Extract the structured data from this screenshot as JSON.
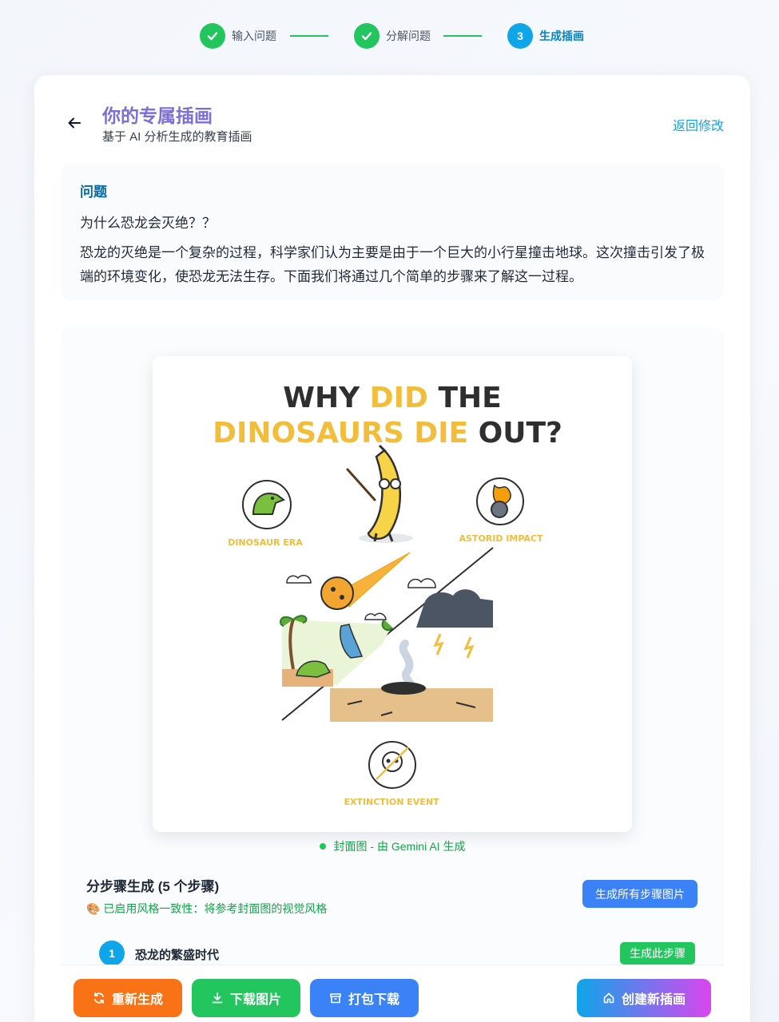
{
  "stepper": {
    "steps": [
      {
        "label": "输入问题",
        "number": "",
        "state": "done"
      },
      {
        "label": "分解问题",
        "number": "",
        "state": "done"
      },
      {
        "label": "生成插画",
        "number": "3",
        "state": "active"
      }
    ]
  },
  "header": {
    "title": "你的专属插画",
    "subtitle": "基于 AI 分析生成的教育插画",
    "back_edit_label": "返回修改"
  },
  "question": {
    "heading": "问题",
    "text": "为什么恐龙会灭绝？？",
    "answer": "恐龙的灭绝是一个复杂的过程，科学家们认为主要是由于一个巨大的小行星撞击地球。这次撞击引发了极端的环境变化，使恐龙无法生存。下面我们将通过几个简单的步骤来了解这一过程。"
  },
  "poster": {
    "title_line1_a": "WHY ",
    "title_line1_b": "DID",
    "title_line1_c": " THE",
    "title_line2_a": "DINOSAURS DIE",
    "title_line2_b": " OUT?",
    "label_dinosaur_era": "DINOSAUR ERA",
    "label_asteroid_impact": "ASTORID IMPACT",
    "label_extinction": "EXTINCTION EVENT",
    "colors": {
      "yellow": "#f2bd3b",
      "dark": "#2f2f2f"
    }
  },
  "caption": "封面图 - 由 Gemini AI 生成",
  "steps_section": {
    "title": "分步骤生成 (5 个步骤)",
    "note": "🎨 已启用风格一致性：将参考封面图的视觉风格",
    "gen_all_label": "生成所有步骤图片",
    "first_step": {
      "number": "1",
      "name": "恐龙的繁盛时代",
      "button": "生成此步骤"
    }
  },
  "actions": {
    "regenerate": "重新生成",
    "download": "下载图片",
    "zip": "打包下载",
    "new": "创建新插画"
  },
  "icons": {
    "check": "check-icon",
    "back": "arrow-left-icon",
    "refresh": "refresh-icon",
    "download": "download-icon",
    "archive": "archive-icon",
    "home": "home-icon"
  }
}
